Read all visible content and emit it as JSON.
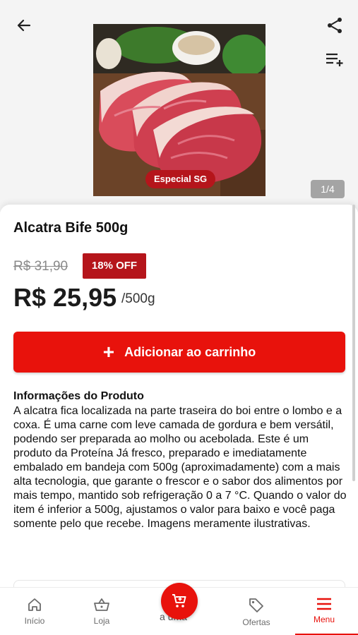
{
  "header": {
    "back_icon": "arrow-left-icon",
    "share_icon": "share-icon",
    "add_to_list_icon": "playlist-add-icon"
  },
  "gallery": {
    "badge": "Especial SG",
    "pager": "1/4"
  },
  "product": {
    "title": "Alcatra Bife 500g",
    "old_price": "R$ 31,90",
    "discount": "18% OFF",
    "price": "R$ 25,95",
    "unit": "/500g"
  },
  "actions": {
    "add_to_cart_label": "Adicionar ao carrinho"
  },
  "info": {
    "heading": "Informações do Produto",
    "body": "A alcatra fica localizada na parte traseira do boi entre o lombo e a coxa. É uma carne com leve camada de gordura e bem versátil, podendo ser preparada ao molho ou acebolada. Este é um produto da Proteína Já fresco, preparado e imediatamente embalado em bandeja com 500g (aproximadamente) com a mais alta tecnologia, que garante o frescor e o sabor dos alimentos por mais tempo, mantido sob refrigeração 0 a 7 °C. Quando o valor do item é inferior a 500g, ajustamos o valor para baixo e você paga somente pelo que recebe. Imagens meramente ilustrativas."
  },
  "bottom_nav": {
    "items": [
      {
        "label": "Início",
        "icon": "home-icon"
      },
      {
        "label": "Loja",
        "icon": "basket-icon"
      },
      {
        "label": "Ofertas",
        "icon": "tag-icon"
      },
      {
        "label": "Menu",
        "icon": "menu-icon"
      }
    ],
    "cart_peek_text": "a uma",
    "cart_icon": "cart-icon",
    "active": "Menu"
  },
  "colors": {
    "accent": "#e8120c",
    "badge": "#b5151b",
    "pager": "#a4a4a4"
  }
}
